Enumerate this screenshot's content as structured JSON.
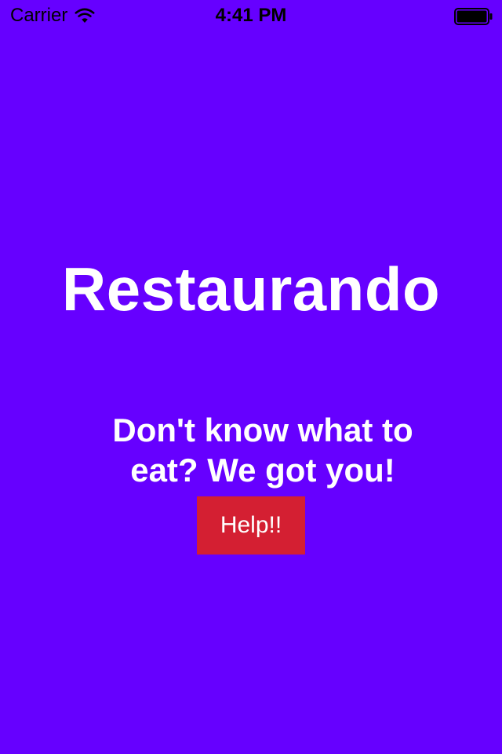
{
  "status_bar": {
    "carrier": "Carrier",
    "time": "4:41 PM",
    "wifi_icon": "wifi-icon",
    "battery_icon": "battery-icon"
  },
  "main": {
    "title": "Restaurando",
    "tagline": "Don't know what to eat? We got you!",
    "help_button_label": "Help!!"
  },
  "colors": {
    "background": "#6600ff",
    "status_text": "#000000",
    "title_text": "#ffffff",
    "button_background": "#d41f32",
    "button_text": "#ffffff"
  }
}
